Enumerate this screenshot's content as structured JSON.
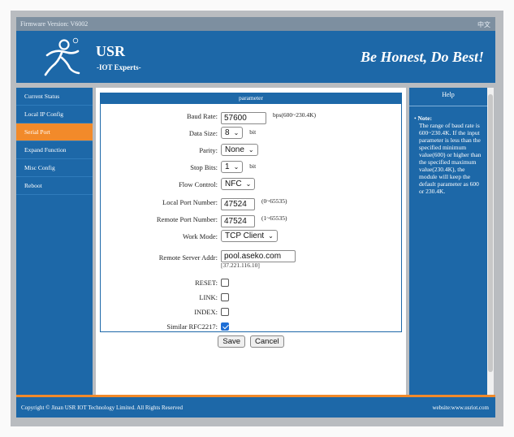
{
  "topbar": {
    "firmware": "Firmware Version: V6002",
    "language": "中文"
  },
  "header": {
    "brand": "USR",
    "tagline": "-IOT Experts-",
    "slogan": "Be Honest, Do Best!"
  },
  "sidebar": {
    "items": [
      {
        "label": "Current Status"
      },
      {
        "label": "Local IP Config"
      },
      {
        "label": "Serial Port",
        "active": true
      },
      {
        "label": "Expand Function"
      },
      {
        "label": "Misc Config"
      },
      {
        "label": "Reboot"
      }
    ]
  },
  "panel": {
    "title": "parameter",
    "baud_rate": {
      "label": "Baud Rate:",
      "value": "57600",
      "unit": "bps(600~230.4K)"
    },
    "data_size": {
      "label": "Data Size:",
      "value": "8",
      "unit": "bit"
    },
    "parity": {
      "label": "Parity:",
      "value": "None"
    },
    "stop_bits": {
      "label": "Stop Bits:",
      "value": "1",
      "unit": "bit"
    },
    "flow_control": {
      "label": "Flow Control:",
      "value": "NFC"
    },
    "local_port": {
      "label": "Local Port Number:",
      "value": "47524",
      "unit": "(0~65535)"
    },
    "remote_port": {
      "label": "Remote Port Number:",
      "value": "47524",
      "unit": "(1~65535)"
    },
    "work_mode": {
      "label": "Work Mode:",
      "value": "TCP Client"
    },
    "remote_server": {
      "label": "Remote Server Addr:",
      "value": "pool.aseko.com",
      "resolved_ip": "[37.221.116.10]"
    },
    "reset": {
      "label": "RESET:",
      "checked": false
    },
    "link": {
      "label": "LINK:",
      "checked": false
    },
    "index": {
      "label": "INDEX:",
      "checked": false
    },
    "rfc2217": {
      "label": "Similar RFC2217:",
      "checked": true
    },
    "save_label": "Save",
    "cancel_label": "Cancel"
  },
  "help": {
    "title": "Help",
    "note_label": "Note:",
    "text": "The range of baud rate is 600~230.4K. If the input parameter is less than the specified minimum value(600) or higher than the specified maximum value(230.4K), the module will keep the default parameter as 600 or 230.4K."
  },
  "footer": {
    "copyright": "Copyright © Jinan USR IOT Technology Limited. All Rights Reserved",
    "website": "website:www.usriot.com"
  },
  "colors": {
    "primary": "#1d68a8",
    "accent": "#f28a2a",
    "topbar": "#7d8fa0",
    "checkbox_on": "#1f6fd6"
  }
}
